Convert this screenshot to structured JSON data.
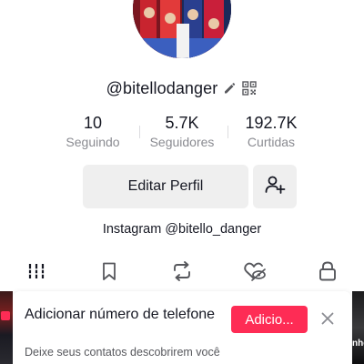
{
  "profile": {
    "username": "@bitellodanger",
    "edit_icon": "pencil-icon",
    "qr_icon": "qr-code-icon"
  },
  "stats": [
    {
      "value": "10",
      "label": "Seguindo"
    },
    {
      "value": "5.7K",
      "label": "Seguidores"
    },
    {
      "value": "192.7K",
      "label": "Curtidas"
    }
  ],
  "actions": {
    "edit_profile_label": "Editar Perfil",
    "add_friend_icon": "add-user-icon"
  },
  "bio": {
    "link_text": "Instagram @bitello_danger"
  },
  "tabs": [
    {
      "icon": "grid-icon",
      "active": true
    },
    {
      "icon": "bookmark-icon",
      "active": false
    },
    {
      "icon": "repost-icon",
      "active": false
    },
    {
      "icon": "liked-heart-icon",
      "active": false
    },
    {
      "icon": "lock-icon",
      "active": false
    }
  ],
  "banner": {
    "title": "Adicionar número de telefone",
    "subtitle": "Deixe seus contatos descobrirem você no TikTok",
    "add_label": "Adicio...",
    "close_icon": "close-icon"
  },
  "grid": {
    "right_thumb_text": "nhe"
  },
  "colors": {
    "primary_text": "#161823",
    "secondary_text": "#8a8b91",
    "button_bg": "#efefef",
    "accent": "#fe2c55"
  }
}
